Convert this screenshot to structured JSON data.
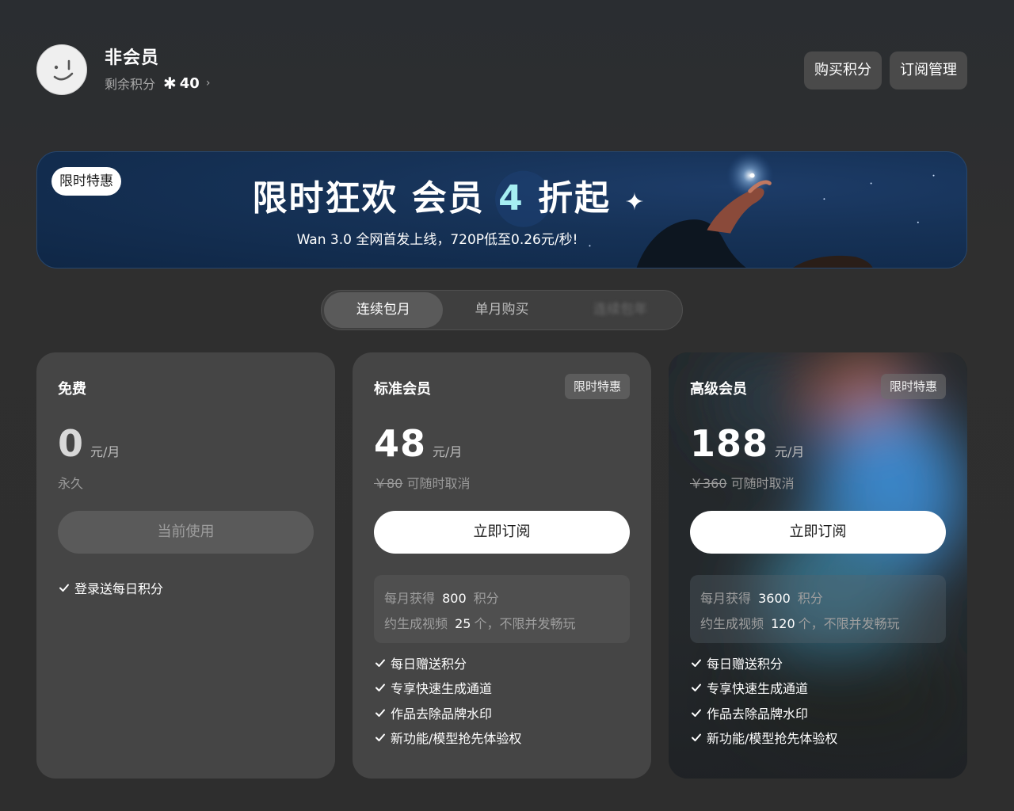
{
  "user": {
    "name": "非会员",
    "points_label": "剩余积分",
    "points_value": "40"
  },
  "top_actions": {
    "buy_points": "购买积分",
    "manage_subscription": "订阅管理"
  },
  "banner": {
    "badge": "限时特惠",
    "title_part1": "限时狂欢  会员 ",
    "title_highlight": "4",
    "title_part2": " 折起",
    "subtitle": "Wan 3.0 全网首发上线，720P低至0.26元/秒!"
  },
  "tabs": [
    {
      "label": "连续包月",
      "active": true
    },
    {
      "label": "单月购买",
      "active": false
    },
    {
      "label": "连续包年",
      "active": false
    }
  ],
  "plans": {
    "free": {
      "name": "免费",
      "price": "0",
      "unit": "元/月",
      "sub": "永久",
      "cta": "当前使用",
      "features": [
        "登录送每日积分"
      ]
    },
    "standard": {
      "name": "标准会员",
      "badge": "限时特惠",
      "price": "48",
      "unit": "元/月",
      "original_price": "￥80",
      "sub": "可随时取消",
      "cta": "立即订阅",
      "quota_label": "每月获得",
      "quota_value": "800",
      "quota_unit": "积分",
      "video_label": "约生成视频",
      "video_value": "25",
      "video_suffix": "个，不限并发畅玩",
      "features": [
        "每日赠送积分",
        "专享快速生成通道",
        "作品去除品牌水印",
        "新功能/模型抢先体验权"
      ]
    },
    "premium": {
      "name": "高级会员",
      "badge": "限时特惠",
      "price": "188",
      "unit": "元/月",
      "original_price": "￥360",
      "sub": "可随时取消",
      "cta": "立即订阅",
      "quota_label": "每月获得",
      "quota_value": "3600",
      "quota_unit": "积分",
      "video_label": "约生成视频",
      "video_value": "120",
      "video_suffix": "个，不限并发畅玩",
      "features": [
        "每日赠送积分",
        "专享快速生成通道",
        "作品去除品牌水印",
        "新功能/模型抢先体验权"
      ]
    }
  }
}
